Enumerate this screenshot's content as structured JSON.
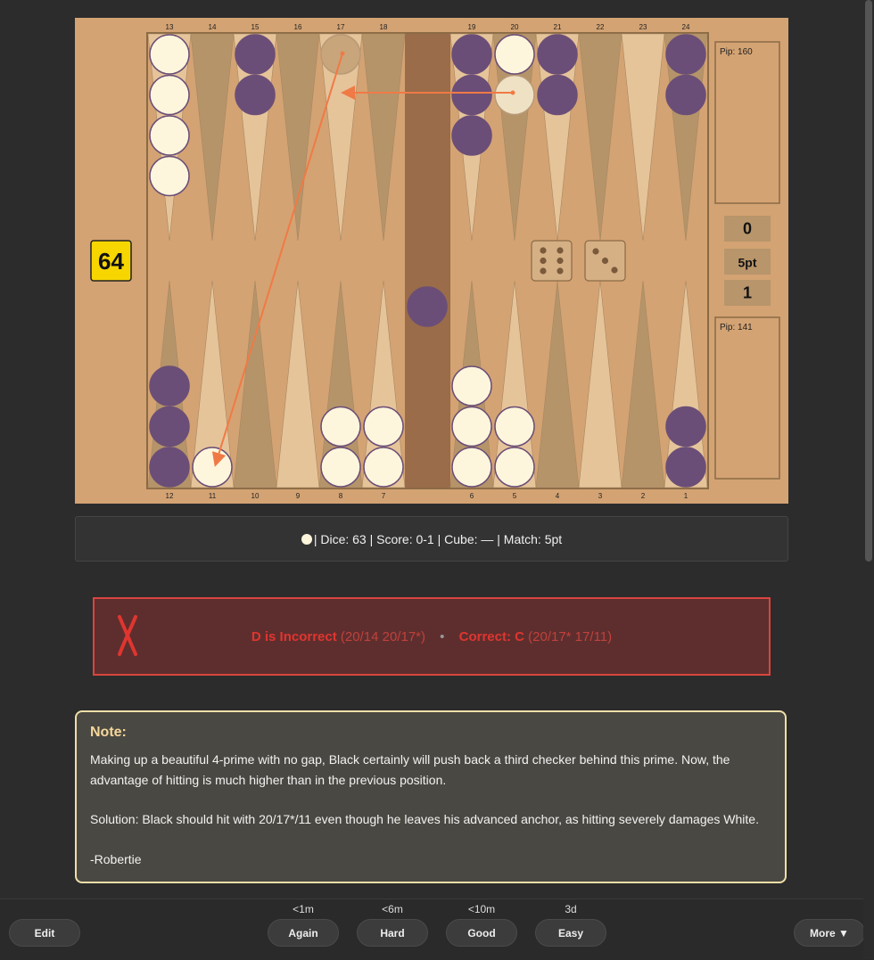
{
  "board": {
    "top_point_labels": [
      "13",
      "14",
      "15",
      "16",
      "17",
      "18",
      "19",
      "20",
      "21",
      "22",
      "23",
      "24"
    ],
    "bottom_point_labels": [
      "12",
      "11",
      "10",
      "9",
      "8",
      "7",
      "6",
      "5",
      "4",
      "3",
      "2",
      "1"
    ],
    "cube_value": "64",
    "pip_top": "Pip: 160",
    "pip_bottom": "Pip: 141",
    "score_top": "0",
    "match_length": "5pt",
    "score_bottom": "1",
    "dice": [
      6,
      3
    ],
    "colors": {
      "board": "#d4a373",
      "point_light": "#e6c49a",
      "point_dark": "#b5946a",
      "bar": "#9a6c4a",
      "white_checker": "#fdf6dc",
      "black_checker": "#6b4e77",
      "checker_border": "#6b4e77",
      "arrow": "#f07a46",
      "cube": "#f7d600"
    },
    "checkers": [
      {
        "point": 13,
        "color": "white",
        "count": 4
      },
      {
        "point": 15,
        "color": "black",
        "count": 2
      },
      {
        "point": 19,
        "color": "black",
        "count": 3
      },
      {
        "point": 20,
        "color": "white",
        "count": 1
      },
      {
        "point": 21,
        "color": "black",
        "count": 2
      },
      {
        "point": 24,
        "color": "black",
        "count": 2
      },
      {
        "point": 12,
        "color": "black",
        "count": 3
      },
      {
        "point": 11,
        "color": "white",
        "count": 1
      },
      {
        "point": 8,
        "color": "white",
        "count": 2
      },
      {
        "point": 7,
        "color": "white",
        "count": 2
      },
      {
        "point": 6,
        "color": "white",
        "count": 3
      },
      {
        "point": 5,
        "color": "white",
        "count": 2
      },
      {
        "point": 1,
        "color": "black",
        "count": 2
      }
    ],
    "ghost_checkers": [
      {
        "point": 17,
        "color": "black"
      },
      {
        "point": 20,
        "color": "white",
        "slot": 2
      }
    ],
    "bar_checkers": [
      {
        "color": "black"
      }
    ],
    "arrows": [
      {
        "from": 20,
        "to": 17
      },
      {
        "from": 17,
        "to": 11
      }
    ]
  },
  "info": {
    "text": "| Dice: 63 | Score: 0-1 | Cube: — | Match: 5pt"
  },
  "result": {
    "icon": "cross-mark-icon",
    "incorrect_label": "D is Incorrect",
    "incorrect_move": "(20/14 20/17*)",
    "separator": "•",
    "correct_label": "Correct: C",
    "correct_move": "(20/17* 17/11)"
  },
  "note": {
    "title": "Note:",
    "p1": "Making up a beautiful 4-prime with no gap, Black certainly will push back a third checker behind this prime. Now, the advantage of hitting is much higher than in the previous position.",
    "p2": "Solution: Black should hit with 20/17*/11 even though he leaves his advanced anchor, as hitting severely damages White.",
    "p3": "-Robertie"
  },
  "footer": {
    "edit_label": "Edit",
    "again_label": "Again",
    "again_interval": "<1m",
    "hard_label": "Hard",
    "hard_interval": "<6m",
    "good_label": "Good",
    "good_interval": "<10m",
    "easy_label": "Easy",
    "easy_interval": "3d",
    "more_label": "More ▼"
  }
}
